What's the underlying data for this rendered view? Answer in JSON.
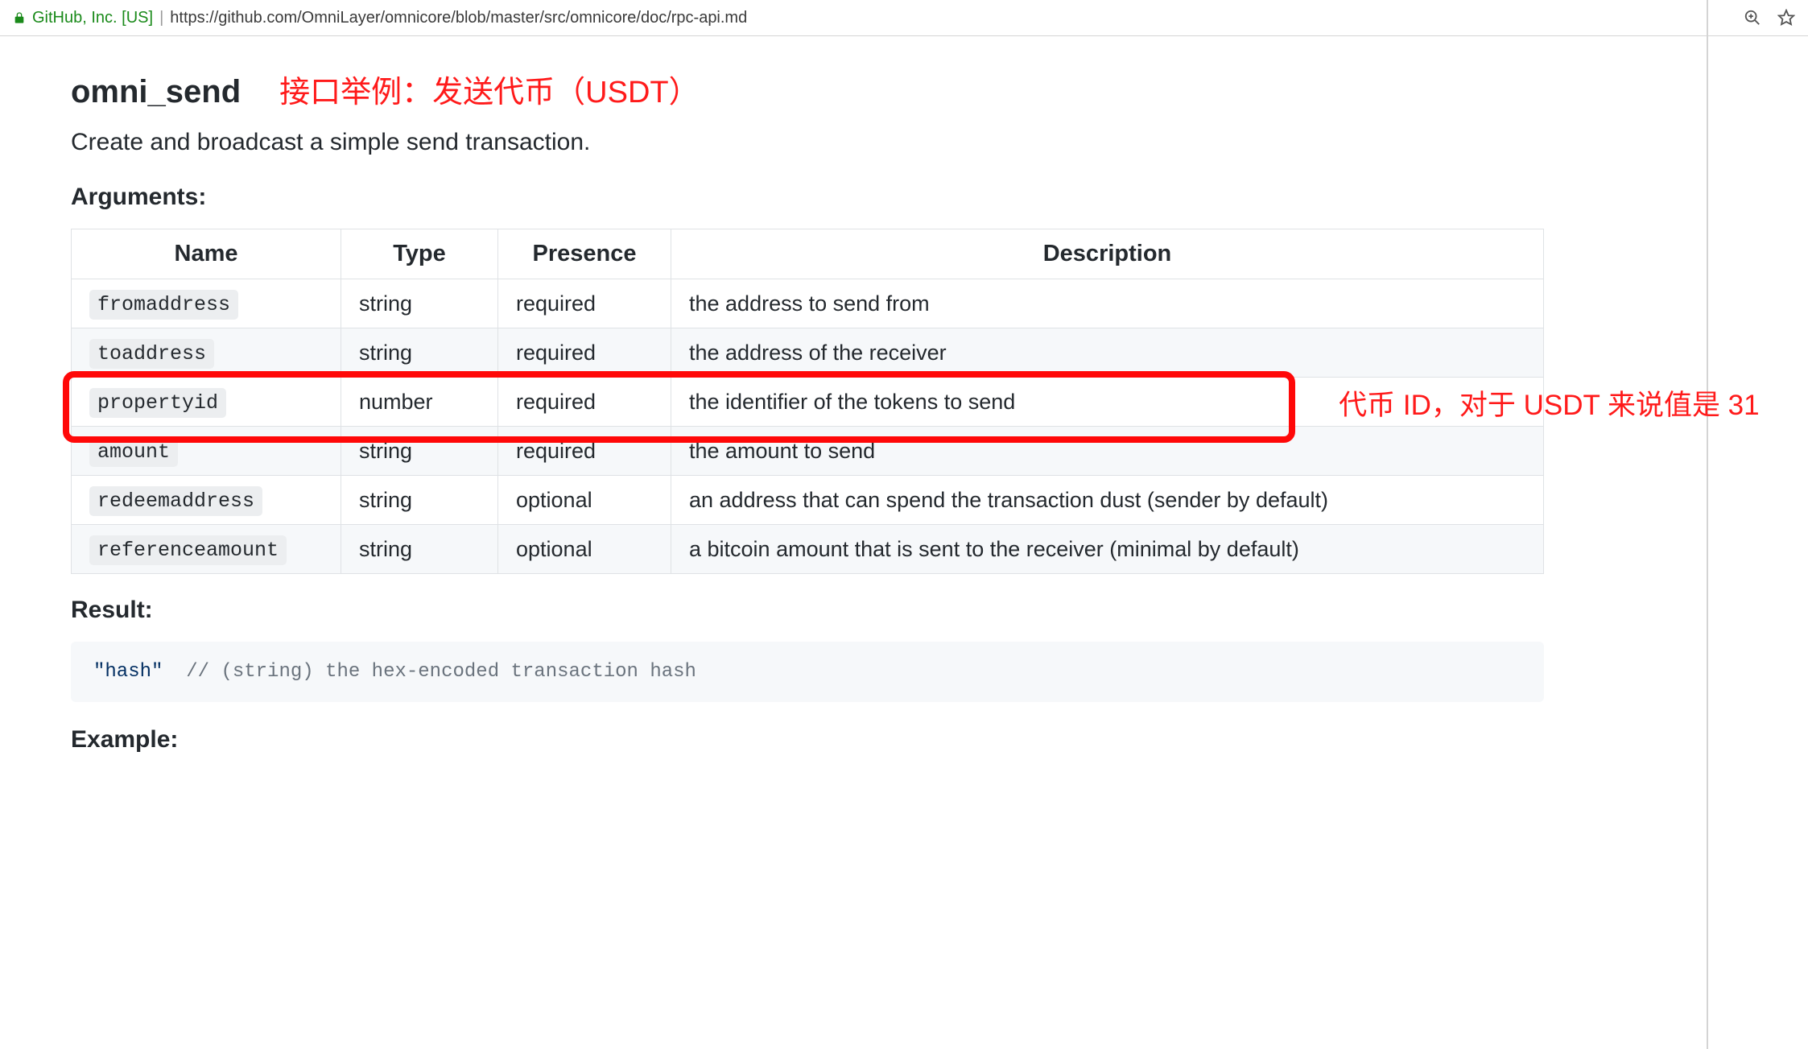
{
  "browser": {
    "site_identity": "GitHub, Inc. [US]",
    "url": "https://github.com/OmniLayer/omnicore/blob/master/src/omnicore/doc/rpc-api.md"
  },
  "heading": {
    "title": "omni_send",
    "annotation": "接口举例：发送代币（USDT）"
  },
  "description": "Create and broadcast a simple send transaction.",
  "sections": {
    "arguments_label": "Arguments:",
    "result_label": "Result:",
    "example_label": "Example:"
  },
  "table": {
    "headers": {
      "c0": "Name",
      "c1": "Type",
      "c2": "Presence",
      "c3": "Description"
    },
    "rows": [
      {
        "name": "fromaddress",
        "type": "string",
        "presence": "required",
        "desc": "the address to send from"
      },
      {
        "name": "toaddress",
        "type": "string",
        "presence": "required",
        "desc": "the address of the receiver"
      },
      {
        "name": "propertyid",
        "type": "number",
        "presence": "required",
        "desc": "the identifier of the tokens to send"
      },
      {
        "name": "amount",
        "type": "string",
        "presence": "required",
        "desc": "the amount to send"
      },
      {
        "name": "redeemaddress",
        "type": "string",
        "presence": "optional",
        "desc": "an address that can spend the transaction dust (sender by default)"
      },
      {
        "name": "referenceamount",
        "type": "string",
        "presence": "optional",
        "desc": "a bitcoin amount that is sent to the receiver (minimal by default)"
      }
    ]
  },
  "row_callout": "代币 ID，对于 USDT 来说值是 31",
  "result_code": {
    "string": "\"hash\"",
    "comment": "// (string) the hex-encoded transaction hash"
  }
}
